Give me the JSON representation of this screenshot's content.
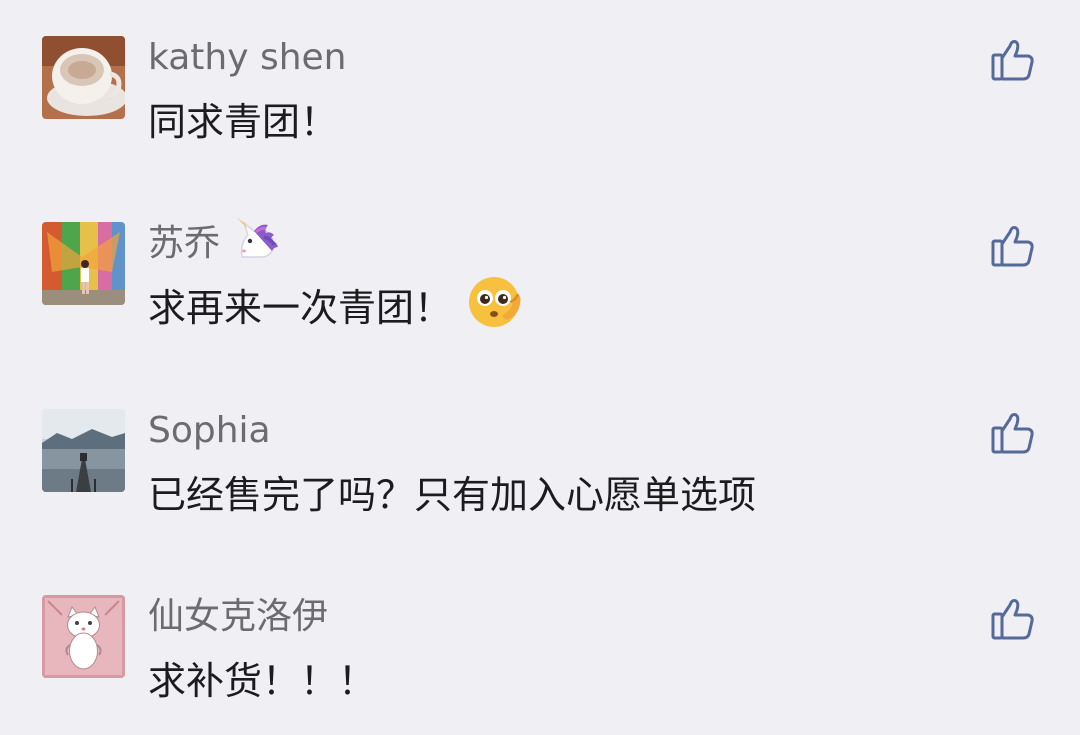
{
  "colors": {
    "background": "#efeff4",
    "name": "#6c6c70",
    "text": "#1c1c1e",
    "like_icon": "#56699b"
  },
  "comments": [
    {
      "name": "kathy shen",
      "text": "同求青团！",
      "avatar_icon": "coffee-cup",
      "name_emoji": "",
      "text_emoji": ""
    },
    {
      "name": "苏乔",
      "text": "求再来一次青团！",
      "avatar_icon": "colorful-mural",
      "name_emoji": "unicorn-icon",
      "text_emoji": "pleading-face-icon"
    },
    {
      "name": "Sophia",
      "text": "已经售完了吗？只有加入心愿单选项",
      "avatar_icon": "lake-pier",
      "name_emoji": "",
      "text_emoji": ""
    },
    {
      "name": "仙女克洛伊",
      "text": "求补货！！！",
      "avatar_icon": "cartoon-cat",
      "name_emoji": "",
      "text_emoji": ""
    }
  ],
  "like_icon": "thumbs-up-icon"
}
